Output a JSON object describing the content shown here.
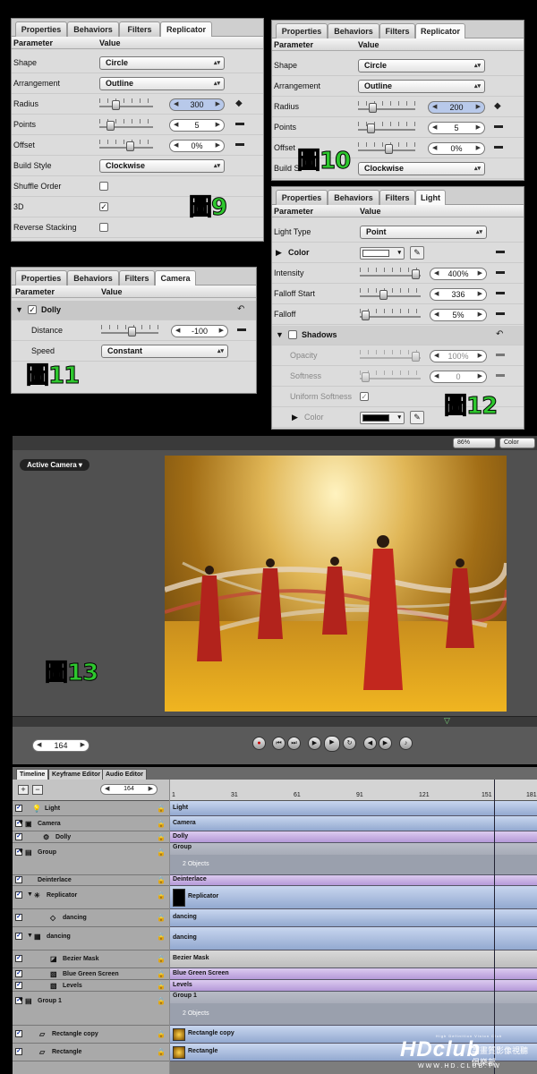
{
  "replicator_panel_a": {
    "tabs": [
      "Properties",
      "Behaviors",
      "Filters",
      "Replicator"
    ],
    "header": {
      "param": "Parameter",
      "value": "Value"
    },
    "rows": {
      "shape": {
        "label": "Shape",
        "value": "Circle"
      },
      "arrangement": {
        "label": "Arrangement",
        "value": "Outline"
      },
      "radius": {
        "label": "Radius",
        "value": "300"
      },
      "points": {
        "label": "Points",
        "value": "5"
      },
      "offset": {
        "label": "Offset",
        "value": "0%"
      },
      "build_style": {
        "label": "Build Style",
        "value": "Clockwise"
      },
      "shuffle": {
        "label": "Shuffle Order"
      },
      "three_d": {
        "label": "3D"
      },
      "reverse": {
        "label": "Reverse Stacking"
      }
    },
    "badge": "圖9"
  },
  "replicator_panel_b": {
    "tabs": [
      "Properties",
      "Behaviors",
      "Filters",
      "Replicator"
    ],
    "header": {
      "param": "Parameter",
      "value": "Value"
    },
    "rows": {
      "shape": {
        "label": "Shape",
        "value": "Circle"
      },
      "arrangement": {
        "label": "Arrangement",
        "value": "Outline"
      },
      "radius": {
        "label": "Radius",
        "value": "200"
      },
      "points": {
        "label": "Points",
        "value": "5"
      },
      "offset": {
        "label": "Offset",
        "value": "0%"
      },
      "build_style": {
        "label": "Build S",
        "value": "Clockwise"
      }
    },
    "badge": "圖10"
  },
  "camera_panel": {
    "tabs": [
      "Properties",
      "Behaviors",
      "Filters",
      "Camera"
    ],
    "header": {
      "param": "Parameter",
      "value": "Value"
    },
    "dolly": "Dolly",
    "distance": {
      "label": "Distance",
      "value": "-100"
    },
    "speed": {
      "label": "Speed",
      "value": "Constant"
    },
    "badge": "圖11"
  },
  "light_panel": {
    "tabs": [
      "Properties",
      "Behaviors",
      "Filters",
      "Light"
    ],
    "header": {
      "param": "Parameter",
      "value": "Value"
    },
    "light_type": {
      "label": "Light Type",
      "value": "Point"
    },
    "color": {
      "label": "Color"
    },
    "intensity": {
      "label": "Intensity",
      "value": "400%"
    },
    "falloff_start": {
      "label": "Falloff Start",
      "value": "336"
    },
    "falloff": {
      "label": "Falloff",
      "value": "5%"
    },
    "shadows": {
      "label": "Shadows"
    },
    "opacity": {
      "label": "Opacity",
      "value": "100%"
    },
    "softness": {
      "label": "Softness",
      "value": "0"
    },
    "uniform": {
      "label": "Uniform Softness"
    },
    "shadow_color": {
      "label": "Color"
    },
    "badge": "圖12"
  },
  "canvas": {
    "zoom": "86%",
    "channel": "Color",
    "active_camera": "Active Camera ▾",
    "badge": "圖13"
  },
  "transport": {
    "frame": "164"
  },
  "timeline": {
    "tabs": [
      "Timeline",
      "Keyframe Editor",
      "Audio Editor"
    ],
    "frame": "164",
    "ruler": [
      "1",
      "31",
      "61",
      "91",
      "121",
      "151",
      "181"
    ],
    "layers": [
      {
        "name": "Light",
        "bar": "Light"
      },
      {
        "name": "Camera",
        "bar": "Camera"
      },
      {
        "name": "Dolly",
        "bar": "Dolly"
      },
      {
        "name": "Group",
        "bar": "Group",
        "sub": "2 Objects"
      },
      {
        "name": "Deinterlace",
        "bar": "Deinterlace"
      },
      {
        "name": "Replicator",
        "bar": "Replicator"
      },
      {
        "name": "dancing",
        "bar": "dancing"
      },
      {
        "name": "dancing",
        "bar": "dancing"
      },
      {
        "name": "Bezier Mask",
        "bar": "Bezier Mask"
      },
      {
        "name": "Blue Green Screen",
        "bar": "Blue Green Screen"
      },
      {
        "name": "Levels",
        "bar": "Levels"
      },
      {
        "name": "Group 1",
        "bar": "Group 1",
        "sub": "2 Objects"
      },
      {
        "name": "Rectangle copy",
        "bar": "Rectangle copy"
      },
      {
        "name": "Rectangle",
        "bar": "Rectangle"
      }
    ]
  },
  "watermark": {
    "logo": "HDclub",
    "tagline": "High Definition Vision Club",
    "chinese": "高畫質影像視聽俱樂部",
    "url": "WWW.HD.CLUB.TW"
  }
}
